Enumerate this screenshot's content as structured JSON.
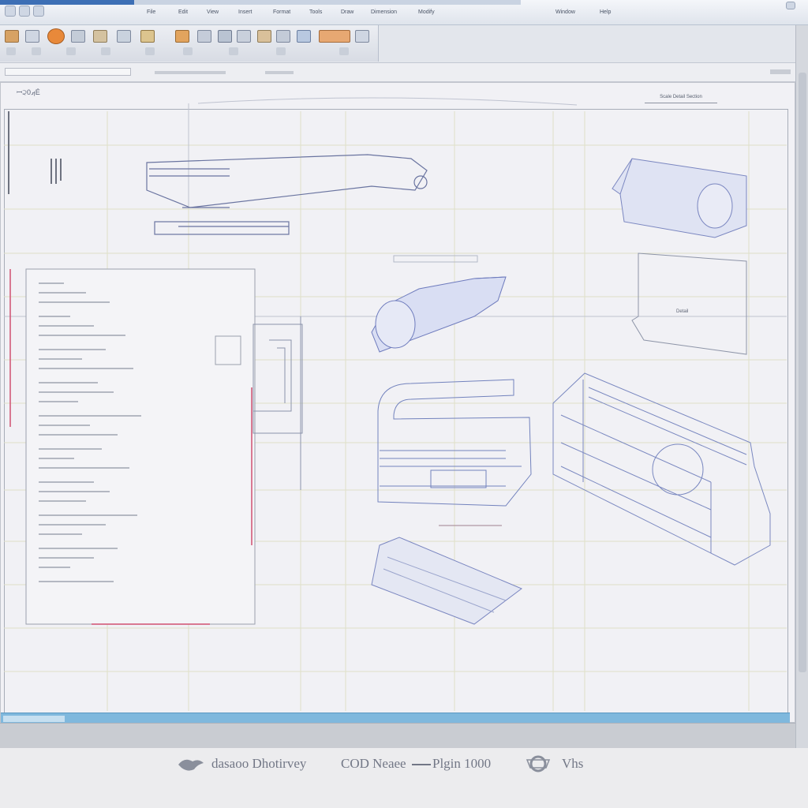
{
  "window": {
    "menu_items": [
      "File",
      "Edit",
      "View",
      "Insert",
      "Format",
      "Tools",
      "Draw",
      "Dimension",
      "Modify",
      "Window",
      "Help"
    ]
  },
  "drawing": {
    "sheet_title": "ꟷ੨ࡕ0É",
    "view_label": "Scale Detail Section",
    "detail_label": "Detail"
  },
  "caption": {
    "part1": "dasaoo Dhotirvey",
    "part2": "COD Neaee",
    "part3": "Plgin 1000",
    "part4": "Vhs"
  },
  "colors": {
    "accent": "#3d6fb5",
    "drawing_line": "#7a86b8",
    "status_blue": "#7fb8dd",
    "highlight_red": "#d05070"
  }
}
